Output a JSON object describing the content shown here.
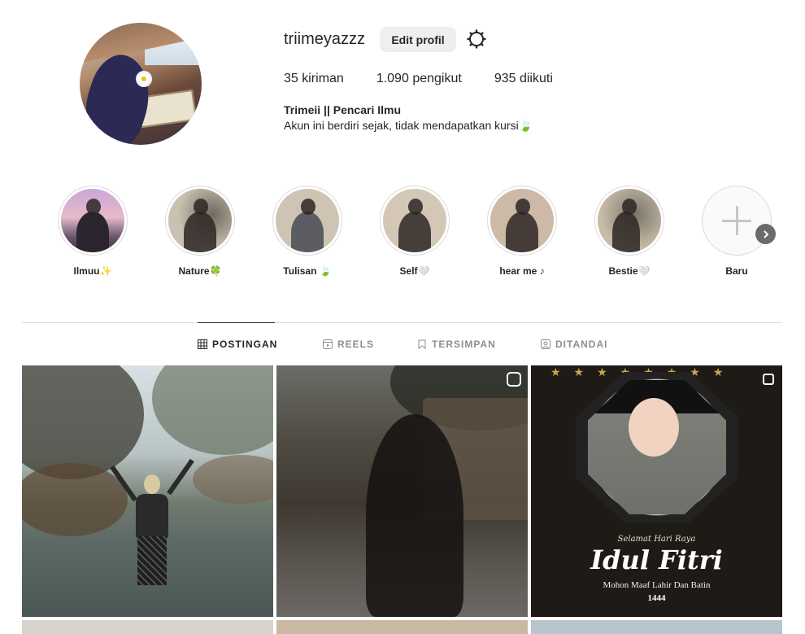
{
  "profile": {
    "username": "triimeyazzz",
    "edit_label": "Edit profil",
    "stats": [
      {
        "value": "35",
        "label": "kiriman"
      },
      {
        "value": "1.090",
        "label": "pengikut"
      },
      {
        "value": "935",
        "label": "diikuti"
      }
    ],
    "full_name": "Trimeii || Pencari Ilmu",
    "bio": "Akun ini berdiri sejak, tidak mendapatkan kursi🍃"
  },
  "highlights": [
    {
      "label": "Ilmuu✨"
    },
    {
      "label": "Nature🍀"
    },
    {
      "label": "Tulisan 🍃"
    },
    {
      "label": "Self🤍"
    },
    {
      "label": "hear me ♪"
    },
    {
      "label": "Bestie🤍"
    },
    {
      "label": "Baru"
    }
  ],
  "tabs": [
    {
      "label": "POSTINGAN"
    },
    {
      "label": "REELS"
    },
    {
      "label": "TERSIMPAN"
    },
    {
      "label": "DITANDAI"
    }
  ],
  "posts": {
    "post3": {
      "greeting_small": "Selamat Hari Raya",
      "greeting_large": "Idul Fitri",
      "greeting_sub": "Mohon Maaf Lahir Dan Batin",
      "year": "1444"
    }
  },
  "icons": {
    "settings": "gear-icon",
    "next": "chevron-right-icon",
    "new_highlight": "plus-icon",
    "tab_posts": "grid-icon",
    "tab_reels": "reels-icon",
    "tab_saved": "bookmark-icon",
    "tab_tagged": "tag-user-icon"
  },
  "colors": {
    "text": "#262626",
    "muted": "#8e8e8e",
    "button_bg": "#efefef",
    "border": "#dbdbdb"
  }
}
